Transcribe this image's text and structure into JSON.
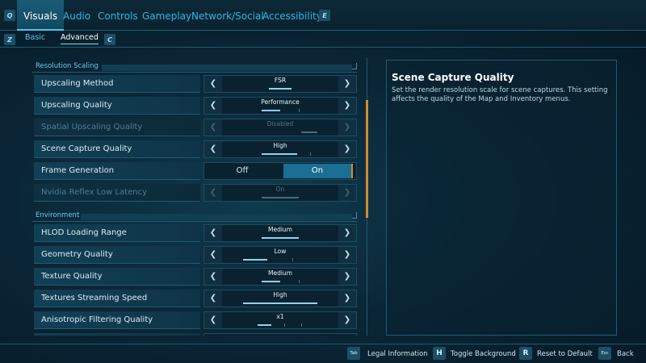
{
  "top_tabs": {
    "left_key": "Q",
    "right_key": "E",
    "items": [
      "Visuals",
      "Audio",
      "Controls",
      "Gameplay",
      "Network/Social",
      "Accessibility"
    ]
  },
  "sub_tabs": {
    "left_key": "Z",
    "right_key": "C",
    "items": [
      "Basic",
      "Advanced"
    ]
  },
  "sections": {
    "resolution": "Resolution Scaling",
    "environment": "Environment"
  },
  "settings": [
    {
      "label": "Upscaling Method",
      "value": "FSR",
      "level": 0.5
    },
    {
      "label": "Upscaling Quality",
      "value": "Performance",
      "level": 0.25
    },
    {
      "label": "Spatial Upscaling Quality",
      "value": "Disabled",
      "level": 1.0
    },
    {
      "label": "Scene Capture Quality",
      "value": "High",
      "level": 0.75
    },
    {
      "label": "Frame Generation",
      "off": "Off",
      "on": "On"
    },
    {
      "label": "Nvidia Reflex Low Latency",
      "value": "On",
      "level": 1.0
    },
    {
      "label": "HLOD Loading Range",
      "value": "Medium",
      "level": 0.5
    },
    {
      "label": "Geometry Quality",
      "value": "Low",
      "level": 0.33
    },
    {
      "label": "Texture Quality",
      "value": "Medium",
      "level": 0.5
    },
    {
      "label": "Textures Streaming Speed",
      "value": "High",
      "level": 1.0
    },
    {
      "label": "Anisotropic Filtering Quality",
      "value": "x1",
      "level": 0.2
    }
  ],
  "description": {
    "title": "Scene Capture Quality",
    "text": "Set the render resolution scale for scene captures. This setting affects the quality of the Map and Inventory menus."
  },
  "bottom": {
    "legal_key": "Tab",
    "legal": "Legal Information",
    "bg_key": "H",
    "bg": "Toggle Background",
    "reset_key": "R",
    "reset": "Reset to Default",
    "back_key": "Esc",
    "back": "Back"
  },
  "colors": {
    "accent": "#46c8f0",
    "scroll_thumb": "#d88a2d",
    "toggle_on": "#1b6f92"
  }
}
